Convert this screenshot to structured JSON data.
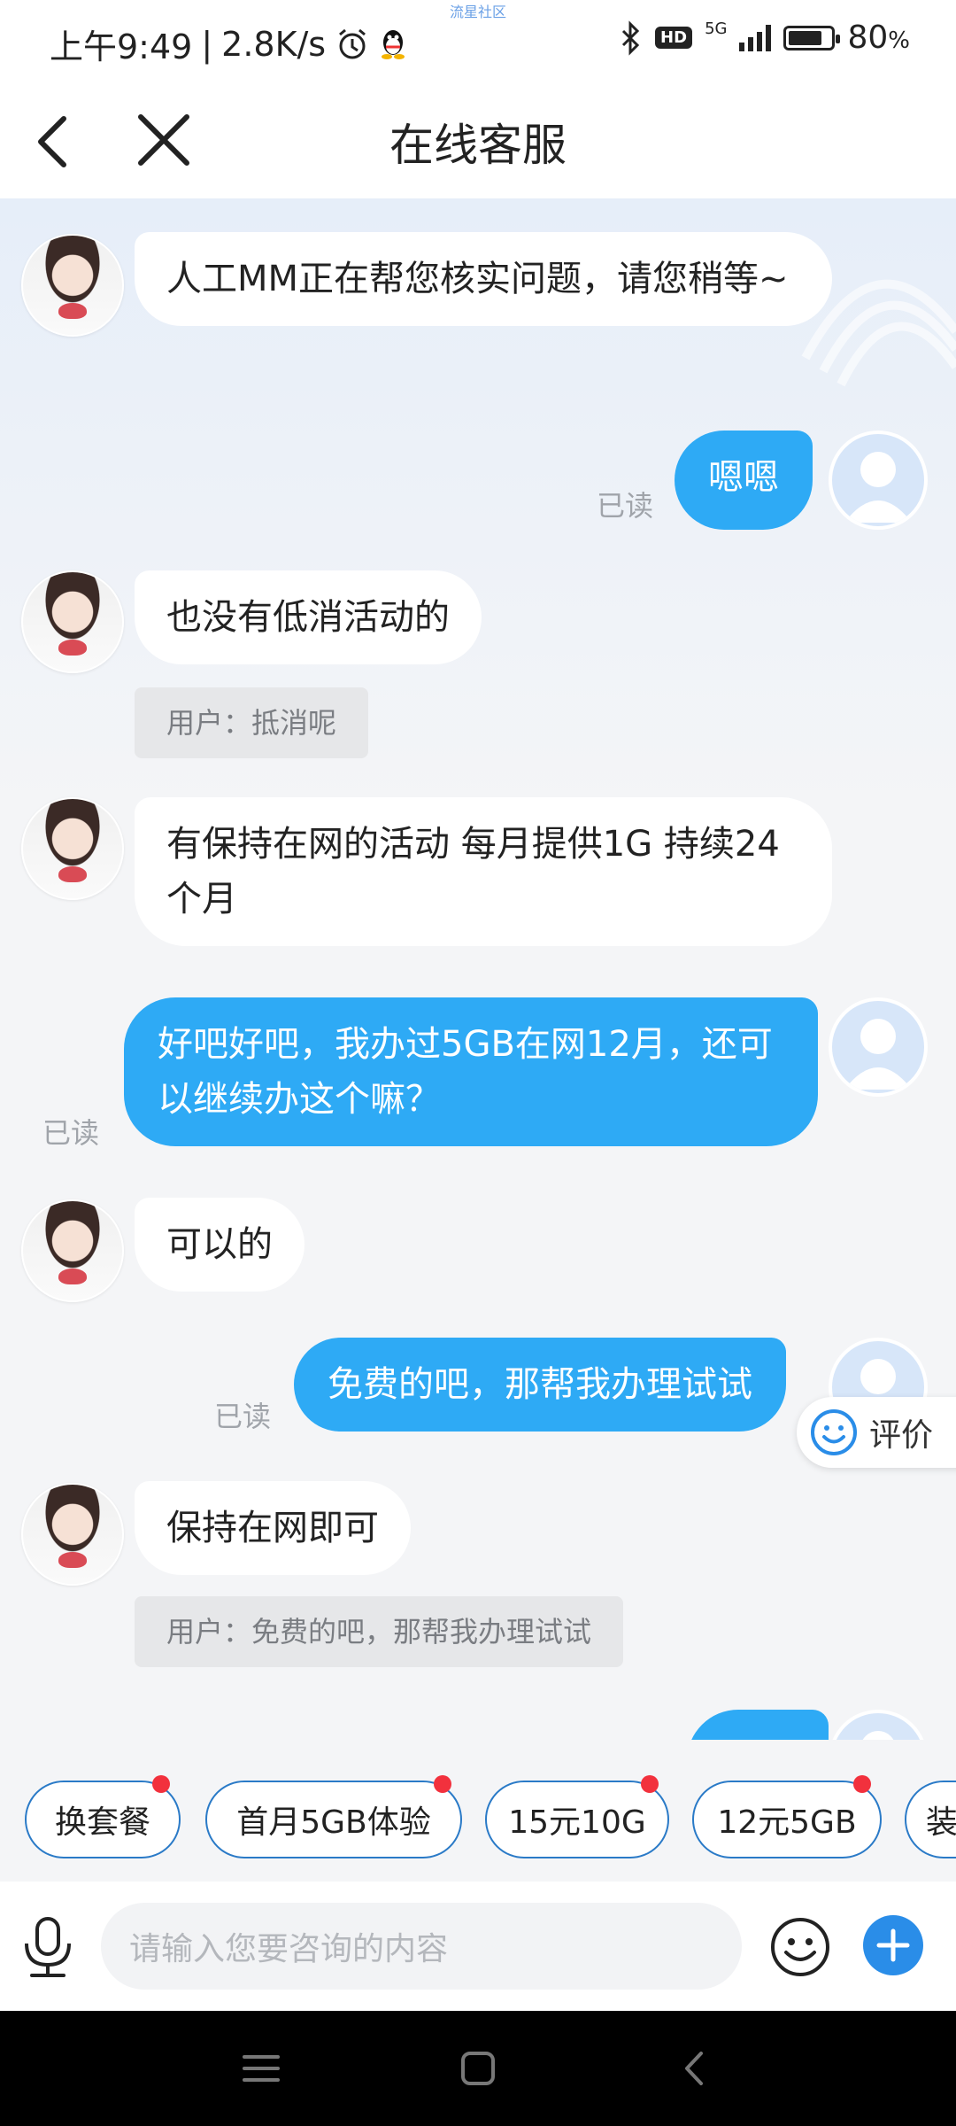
{
  "status_bar": {
    "time": "上午9:49",
    "separator": "|",
    "net_speed": "2.8K/s",
    "watermark": "流星社区",
    "hd": "HD",
    "network": "5G",
    "battery": "80",
    "battery_unit": "%",
    "battery_level": 0.8
  },
  "header": {
    "title": "在线客服"
  },
  "messages": [
    {
      "from": "agent",
      "text": "人工MM正在帮您核实问题，请您稍等~"
    },
    {
      "from": "user",
      "text": "嗯嗯",
      "status": "已读"
    },
    {
      "from": "agent",
      "text": "也没有低消活动的",
      "quote": "用户：抵消呢"
    },
    {
      "from": "agent",
      "text": "有保持在网的活动 每月提供1G 持续24个月"
    },
    {
      "from": "user",
      "text": "好吧好吧，我办过5GB在网12月，还可以继续办这个嘛？",
      "status": "已读"
    },
    {
      "from": "agent",
      "text": "可以的"
    },
    {
      "from": "user",
      "text": "免费的吧，那帮我办理试试",
      "status": "已读"
    },
    {
      "from": "agent",
      "text": "保持在网即可",
      "quote": "用户：免费的吧，那帮我办理试试"
    }
  ],
  "rate_button": {
    "label": "评价"
  },
  "quick_chips": [
    {
      "label": "换套餐"
    },
    {
      "label": "首月5GB体验"
    },
    {
      "label": "15元10G"
    },
    {
      "label": "12元5GB"
    },
    {
      "label": "装"
    }
  ],
  "input": {
    "placeholder": "请输入您要咨询的内容"
  },
  "colors": {
    "user_bubble": "#2eaaf5",
    "chip_border": "#2a7ac7",
    "badge_dot": "#f2313d",
    "send_plus": "#2a8de8"
  }
}
